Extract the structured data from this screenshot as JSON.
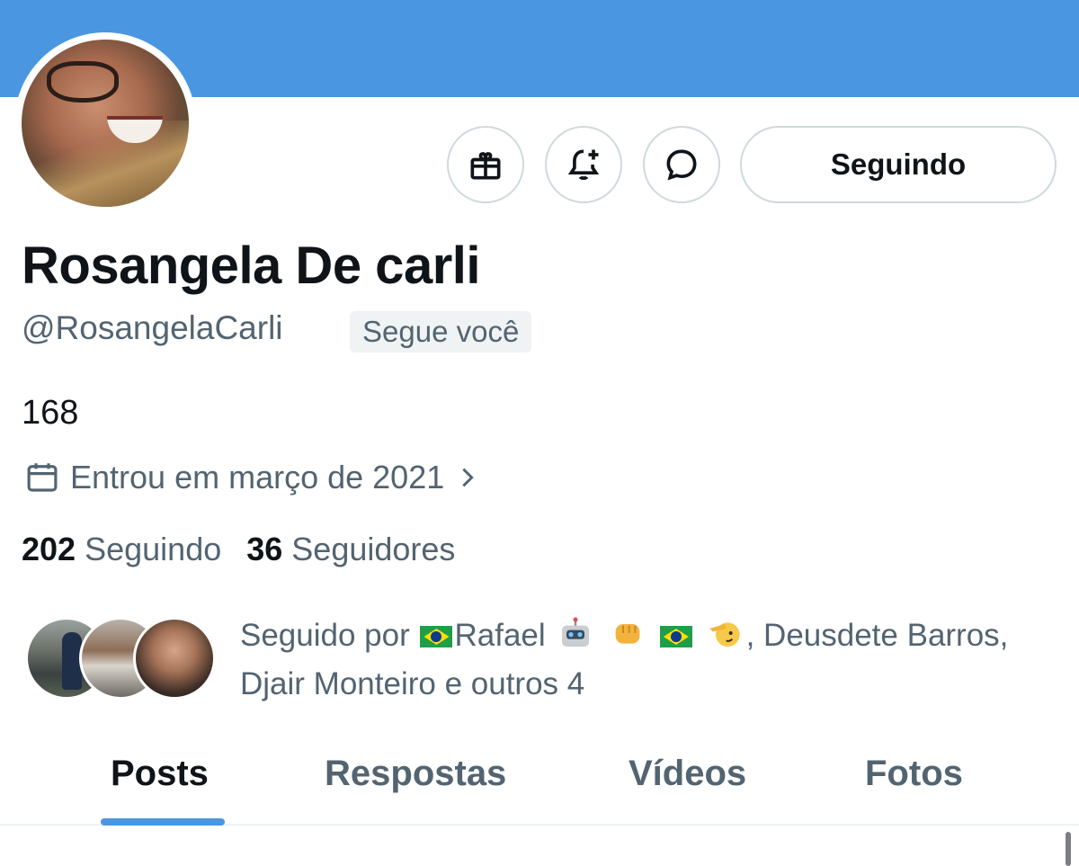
{
  "profile": {
    "name": "Rosangela De carli",
    "handle": "@RosangelaCarli",
    "follows_you_badge": "Segue você",
    "bio": "168",
    "joined": "Entrou em março de 2021",
    "following_count": "202",
    "following_label": "Seguindo",
    "followers_count": "36",
    "followers_label": "Seguidores"
  },
  "actions": {
    "gift_icon": "gift-icon",
    "notify_icon": "bell-plus-icon",
    "message_icon": "message-bubble-icon",
    "follow_button_label": "Seguindo"
  },
  "followed_by": {
    "prefix": "Seguido por ",
    "name1": "Rafael",
    "rest1": ", Deusdete Barros,",
    "rest2": "Djair Monteiro e outros 4"
  },
  "tabs": [
    {
      "label": "Posts",
      "active": true
    },
    {
      "label": "Respostas",
      "active": false
    },
    {
      "label": "Vídeos",
      "active": false
    },
    {
      "label": "Fotos",
      "active": false
    }
  ],
  "colors": {
    "banner": "#4a96e0",
    "accent": "#4a96e0",
    "secondary_text": "#536471"
  }
}
